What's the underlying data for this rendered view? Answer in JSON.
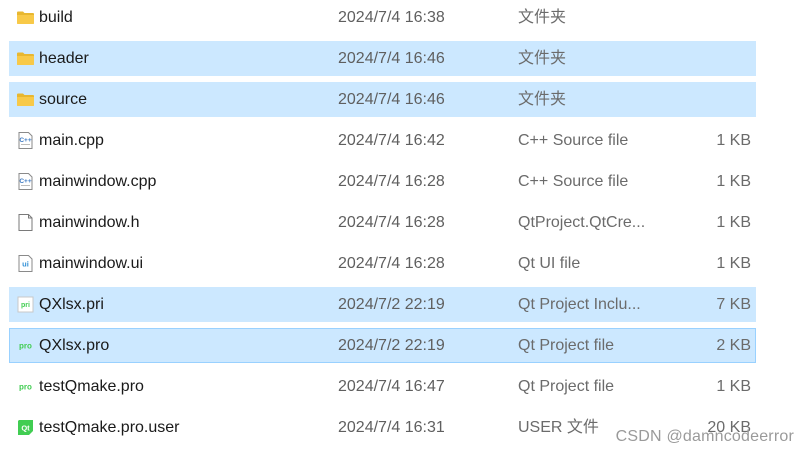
{
  "files": [
    {
      "name": "build",
      "date": "2024/7/4 16:38",
      "type": "文件夹",
      "size": "",
      "icon": "folder-icon",
      "state": ""
    },
    {
      "name": "header",
      "date": "2024/7/4 16:46",
      "type": "文件夹",
      "size": "",
      "icon": "folder-icon",
      "state": "selected"
    },
    {
      "name": "source",
      "date": "2024/7/4 16:46",
      "type": "文件夹",
      "size": "",
      "icon": "folder-icon",
      "state": "selected"
    },
    {
      "name": "main.cpp",
      "date": "2024/7/4 16:42",
      "type": "C++ Source file",
      "size": "1 KB",
      "icon": "cpp-file-icon",
      "state": ""
    },
    {
      "name": "mainwindow.cpp",
      "date": "2024/7/4 16:28",
      "type": "C++ Source file",
      "size": "1 KB",
      "icon": "cpp-file-icon",
      "state": ""
    },
    {
      "name": "mainwindow.h",
      "date": "2024/7/4 16:28",
      "type": "QtProject.QtCre...",
      "size": "1 KB",
      "icon": "blank-file-icon",
      "state": ""
    },
    {
      "name": "mainwindow.ui",
      "date": "2024/7/4 16:28",
      "type": "Qt UI file",
      "size": "1 KB",
      "icon": "ui-file-icon",
      "state": ""
    },
    {
      "name": "QXlsx.pri",
      "date": "2024/7/2 22:19",
      "type": "Qt Project Inclu...",
      "size": "7 KB",
      "icon": "pri-file-icon",
      "state": "selected"
    },
    {
      "name": "QXlsx.pro",
      "date": "2024/7/2 22:19",
      "type": "Qt Project file",
      "size": "2 KB",
      "icon": "pro-file-icon",
      "state": "focused"
    },
    {
      "name": "testQmake.pro",
      "date": "2024/7/4 16:47",
      "type": "Qt Project file",
      "size": "1 KB",
      "icon": "pro-file-icon",
      "state": ""
    },
    {
      "name": "testQmake.pro.user",
      "date": "2024/7/4 16:31",
      "type": "USER 文件",
      "size": "20 KB",
      "icon": "qt-user-file-icon",
      "state": ""
    }
  ],
  "watermark": "CSDN @damncodeerror",
  "colors": {
    "selection": "#cce8ff",
    "focus_border": "#99d1ff",
    "folder": "#f8c948",
    "qt_green": "#41cd52",
    "cpp_blue": "#3b78c2"
  }
}
